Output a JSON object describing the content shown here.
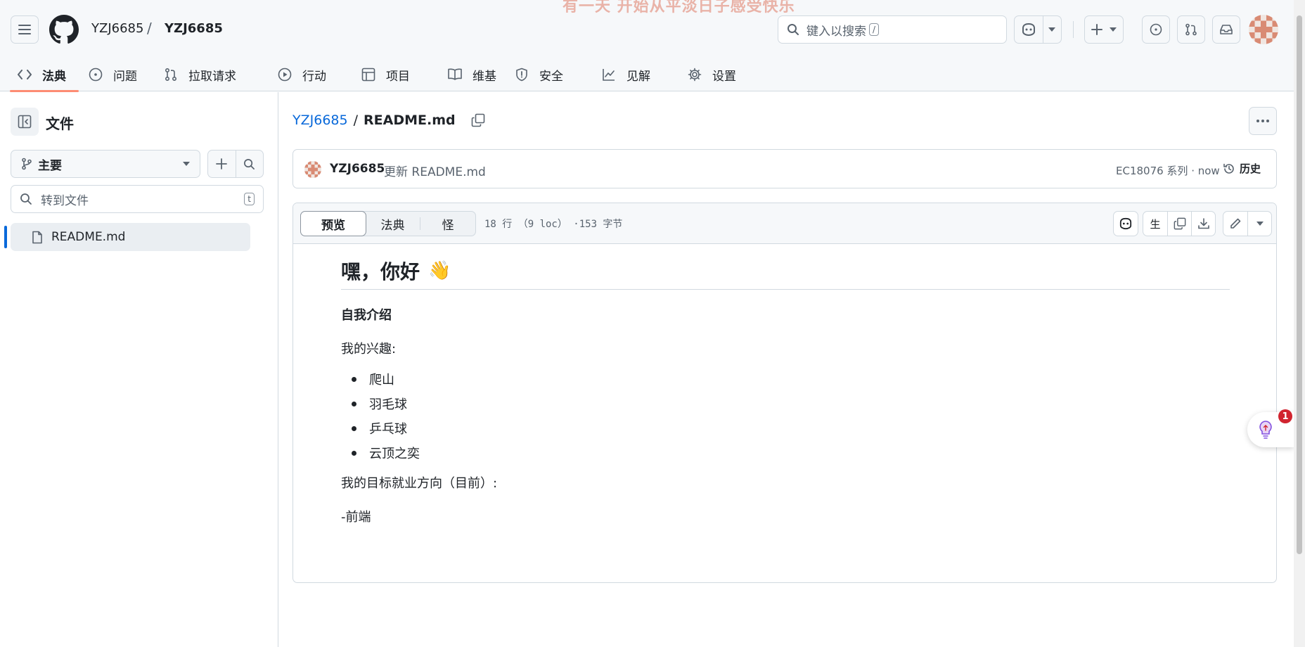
{
  "header": {
    "watermark": "有一天 开始从平淡日子感受快乐",
    "owner": "YZJ6685",
    "separator": "/",
    "repo": "YZJ6685",
    "search_placeholder": "键入以搜索",
    "search_shortcut": "/"
  },
  "repo_tabs": [
    {
      "label": "法典",
      "icon": "code-icon"
    },
    {
      "label": "问题",
      "icon": "issue-icon"
    },
    {
      "label": "拉取请求",
      "icon": "pull-request-icon"
    },
    {
      "label": "行动",
      "icon": "play-icon"
    },
    {
      "label": "项目",
      "icon": "table-icon"
    },
    {
      "label": "维基",
      "icon": "book-icon"
    },
    {
      "label": "安全",
      "icon": "shield-icon"
    },
    {
      "label": "见解",
      "icon": "graph-icon"
    },
    {
      "label": "设置",
      "icon": "gear-icon"
    }
  ],
  "sidebar": {
    "title": "文件",
    "branch": "主要",
    "goto_placeholder": "转到文件",
    "goto_shortcut": "t",
    "files": [
      {
        "name": "README.md"
      }
    ]
  },
  "breadcrumb": {
    "repo_link": "YZJ6685",
    "separator": "/",
    "file": "README.md"
  },
  "commit": {
    "author": "YZJ6685",
    "message": "更新 README.md",
    "meta": "EC18076 系列 · now",
    "history_label": "历史"
  },
  "file_header": {
    "tabs": [
      "预览",
      "法典",
      "怪"
    ],
    "info": "18 行 （9 loc） ·153 字节",
    "raw_label": "生"
  },
  "readme": {
    "heading": "嘿，你好",
    "heading_emoji": "👋",
    "intro": "自我介绍",
    "interests_label": "我的兴趣:",
    "interests": [
      "爬山",
      "羽毛球",
      "乒乓球",
      "云顶之奕"
    ],
    "goal_label": "我的目标就业方向（目前）:",
    "goal": "-前端"
  },
  "float_widget": {
    "badge": "1"
  },
  "colors": {
    "accent_blue": "#0969da",
    "tab_underline": "#fd8c73",
    "border": "#d1d9e0",
    "header_bg": "#f6f8fa"
  }
}
